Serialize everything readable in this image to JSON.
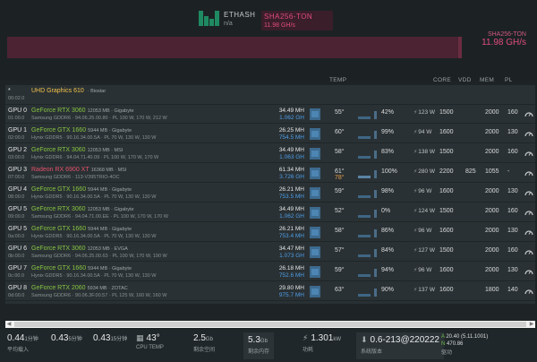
{
  "algorithms": [
    {
      "name": "ETHASH",
      "sub": "n/a"
    },
    {
      "name": "SHA256-TON",
      "sub": "11.98 GH/s"
    }
  ],
  "hash_summary": {
    "algo": "SHA256-TON",
    "rate": "11.98 GH/s"
  },
  "columns": {
    "temp": "TEMP",
    "core": "CORE",
    "vdd": "VDD",
    "mem": "MEM",
    "pl": "PL"
  },
  "igpu": {
    "label": "*",
    "time": "00:02.0",
    "name": "UHD Graphics 610",
    "detail": "· Biostar"
  },
  "gpus": [
    {
      "label": "GPU 0",
      "bus": "01:00.0",
      "name": "GeForce RTX 3060",
      "brand": "nvidia",
      "mem": "12053 MB · Gigabyte",
      "detail": "Samsung GDDR6 · 94.06.25.00.80 · PL 100 W, 170 W, 212 W",
      "hash": "34.49 MH",
      "eff": "1.062 GH",
      "temp": "55°",
      "fan": "42%",
      "power": "123 W",
      "core": "1500",
      "vdd": "",
      "memclk": "2000",
      "pl": "160"
    },
    {
      "label": "GPU 1",
      "bus": "02:00.0",
      "name": "GeForce GTX 1660",
      "brand": "nvidia",
      "mem": "5944 MB · Gigabyte",
      "detail": "Hynix GDDR5 · 90.16.34.00.5A · PL 70 W, 130 W, 130 W",
      "hash": "26.25 MH",
      "eff": "754.5 MH",
      "temp": "60°",
      "fan": "99%",
      "power": "94 W",
      "core": "1600",
      "vdd": "",
      "memclk": "2000",
      "pl": "130"
    },
    {
      "label": "GPU 2",
      "bus": "03:00.0",
      "name": "GeForce RTX 3060",
      "brand": "nvidia",
      "mem": "12053 MB · MSI",
      "detail": "Hynix GDDR6 · 94.04.71.40.09 · PL 100 W, 170 W, 170 W",
      "hash": "34.49 MH",
      "eff": "1.063 GH",
      "temp": "58°",
      "fan": "83%",
      "power": "138 W",
      "core": "1500",
      "vdd": "",
      "memclk": "2000",
      "pl": "160"
    },
    {
      "label": "GPU 3",
      "bus": "07:00.0",
      "name": "Radeon RX 6900 XT",
      "brand": "amd",
      "mem": "16368 MB · MSI",
      "detail": "Samsung GDDR6 · 113-V395TRIO-4OC",
      "hash": "61.34 MH",
      "eff": "3.726 GH",
      "temp": "61°",
      "temp2": "78°",
      "fan": "100%",
      "power": "280 W",
      "core": "2200",
      "vdd": "825",
      "memclk": "1055",
      "pl": "-"
    },
    {
      "label": "GPU 4",
      "bus": "08:00.0",
      "name": "GeForce GTX 1660",
      "brand": "nvidia",
      "mem": "5944 MB · Gigabyte",
      "detail": "Hynix GDDR5 · 90.16.34.00.5A · PL 70 W, 130 W, 130 W",
      "hash": "26.21 MH",
      "eff": "753.5 MH",
      "temp": "59°",
      "fan": "98%",
      "power": "96 W",
      "core": "1600",
      "vdd": "",
      "memclk": "2000",
      "pl": "130"
    },
    {
      "label": "GPU 5",
      "bus": "09:00.0",
      "name": "GeForce RTX 3060",
      "brand": "nvidia",
      "mem": "12053 MB · Gigabyte",
      "detail": "Samsung GDDR6 · 94.04.71.00.EE · PL 100 W, 170 W, 170 W",
      "hash": "34.49 MH",
      "eff": "1.062 GH",
      "temp": "52°",
      "fan": "0%",
      "power": "124 W",
      "core": "1500",
      "vdd": "",
      "memclk": "2000",
      "pl": "160"
    },
    {
      "label": "GPU 5",
      "bus": "0a:00.0",
      "name": "GeForce GTX 1660",
      "brand": "nvidia",
      "mem": "5944 MB · Gigabyte",
      "detail": "Hynix GDDR5 · 90.16.34.00.5A · PL 70 W, 130 W, 130 W",
      "hash": "26.21 MH",
      "eff": "753.4 MH",
      "temp": "58°",
      "fan": "86%",
      "power": "96 W",
      "core": "1600",
      "vdd": "",
      "memclk": "2000",
      "pl": "130"
    },
    {
      "label": "GPU 6",
      "bus": "0b:00.0",
      "name": "GeForce RTX 3060",
      "brand": "nvidia",
      "mem": "12053 MB · EVGA",
      "detail": "Samsung GDDR6 · 94.06.25.00.63 · PL 100 W, 170 W, 190 W",
      "hash": "34.47 MH",
      "eff": "1.073 GH",
      "temp": "57°",
      "fan": "84%",
      "power": "127 W",
      "core": "1500",
      "vdd": "",
      "memclk": "2000",
      "pl": "160"
    },
    {
      "label": "GPU 7",
      "bus": "0c:00.0",
      "name": "GeForce GTX 1660",
      "brand": "nvidia",
      "mem": "5944 MB · Gigabyte",
      "detail": "Hynix GDDR5 · 90.16.34.00.5A · PL 70 W, 130 W, 130 W",
      "hash": "26.18 MH",
      "eff": "752.6 MH",
      "temp": "59°",
      "fan": "94%",
      "power": "96 W",
      "core": "1600",
      "vdd": "",
      "memclk": "2000",
      "pl": "130"
    },
    {
      "label": "GPU 8",
      "bus": "0d:00.0",
      "name": "GeForce RTX 2060",
      "brand": "nvidia",
      "mem": "5934 MB · ZOTAC",
      "detail": "Samsung GDDR6 · 90.06.3F.00.57 · PL 125 W, 160 W, 160 W",
      "hash": "29.80 MH",
      "eff": "975.7 MH",
      "temp": "63°",
      "fan": "90%",
      "power": "137 W",
      "core": "1600",
      "vdd": "",
      "memclk": "1800",
      "pl": "140"
    }
  ],
  "footer": {
    "la1": {
      "value": "0.44",
      "unit": "1分钟"
    },
    "la5": {
      "value": "0.43",
      "unit": "5分钟"
    },
    "la15": {
      "value": "0.43",
      "unit": "15分钟"
    },
    "la_caption": "平均载入",
    "cpu_temp": "43°",
    "cpu_caption": "CPU TEMP",
    "disk_free": {
      "value": "2.5",
      "unit": "Gb",
      "caption": "剩余空间"
    },
    "mem_free": {
      "value": "5.3",
      "unit": "Gb",
      "caption": "剩余内存"
    },
    "power": {
      "value": "1.301",
      "unit": "kW",
      "caption": "功耗"
    },
    "version": {
      "value": "0.6-213@220222",
      "caption": "系统版本"
    },
    "drivers": {
      "a_label": "A",
      "a": "20.40 (5.11.1001)",
      "n_label": "N",
      "n": "470.86",
      "caption": "驱动"
    }
  },
  "colors": {
    "nvidia": "#85c341",
    "amd": "#e2506a",
    "intel": "#f2c24a",
    "accent": "#e04c7d",
    "hash_blue": "#4e9ee8"
  }
}
